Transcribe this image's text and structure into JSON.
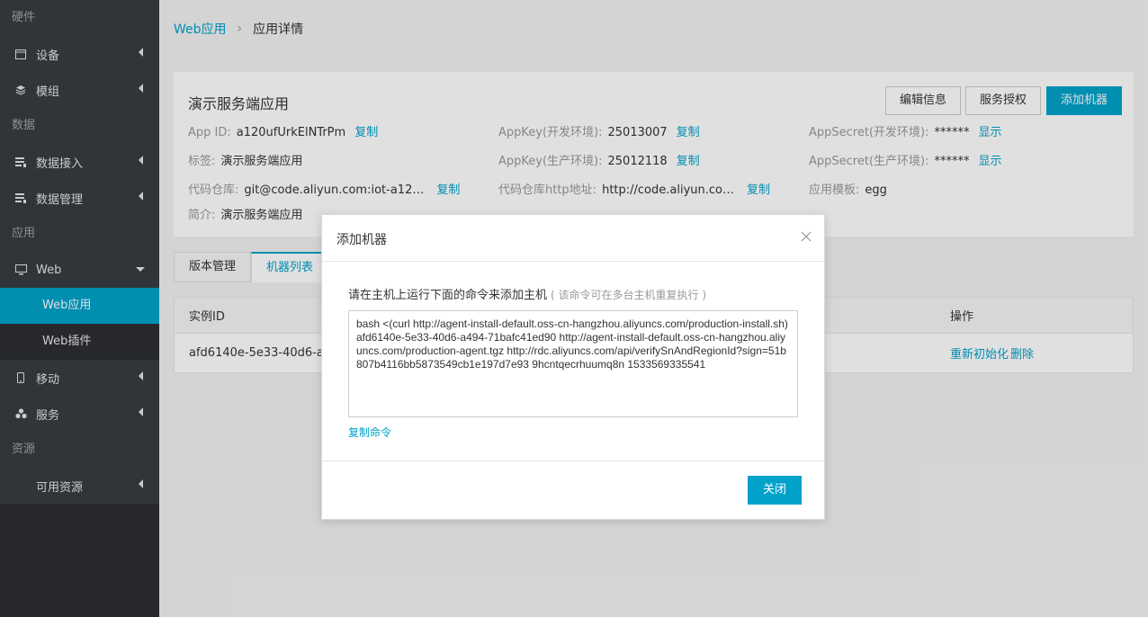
{
  "sidebar": {
    "sections": {
      "hardware": "硬件",
      "data": "数据",
      "app": "应用",
      "resource": "资源"
    },
    "items": {
      "device": "设备",
      "module": "模组",
      "data_access": "数据接入",
      "data_manage": "数据管理",
      "web": "Web",
      "web_app": "Web应用",
      "web_plugin": "Web插件",
      "mobile": "移动",
      "service": "服务",
      "available_resource": "可用资源"
    }
  },
  "breadcrumb": {
    "parent": "Web应用",
    "separator": "›",
    "current": "应用详情"
  },
  "info": {
    "title": "演示服务端应用",
    "buttons": {
      "edit": "编辑信息",
      "auth": "服务授权",
      "add_machine": "添加机器"
    },
    "app_id_label": "App ID:",
    "app_id_value": "a120ufUrkElNTrPm",
    "copy": "复制",
    "tag_label": "标签:",
    "tag_value": "演示服务端应用",
    "repo_label": "代码仓库:",
    "repo_value": "git@code.aliyun.com:iot-a12…",
    "desc_label": "简介:",
    "desc_value": "演示服务端应用",
    "appkey_dev_label": "AppKey(开发环境):",
    "appkey_dev_value": "25013007",
    "appkey_prod_label": "AppKey(生产环境):",
    "appkey_prod_value": "25012118",
    "repo_http_label": "代码仓库http地址:",
    "repo_http_value": "http://code.aliyun.co…",
    "secret_dev_label": "AppSecret(开发环境):",
    "secret_dev_value": "******",
    "secret_prod_label": "AppSecret(生产环境):",
    "secret_prod_value": "******",
    "show": "显示",
    "template_label": "应用模板:",
    "template_value": "egg"
  },
  "tabs": {
    "version": "版本管理",
    "machines": "机器列表"
  },
  "table": {
    "headers": {
      "instance_id": "实例ID",
      "actions": "操作"
    },
    "rows": [
      {
        "instance_id": "afd6140e-5e33-40d6-a494-",
        "reinit": "重新初始化",
        "delete": "删除"
      }
    ]
  },
  "dialog": {
    "title": "添加机器",
    "description": "请在主机上运行下面的命令来添加主机",
    "hint": "( 该命令可在多台主机重复执行 )",
    "command": "bash <(curl http://agent-install-default.oss-cn-hangzhou.aliyuncs.com/production-install.sh) afd6140e-5e33-40d6-a494-71bafc41ed90 http://agent-install-default.oss-cn-hangzhou.aliyuncs.com/production-agent.tgz http://rdc.aliyuncs.com/api/verifySnAndRegionId?sign=51b807b4116bb5873549cb1e197d7e93 9hcntqecrhuumq8n 1533569335541",
    "copy_command": "复制命令",
    "close_button": "关闭"
  },
  "colors": {
    "accent": "#00a2ca",
    "sidebar_bg": "#373d41",
    "sidebar_dark": "#2c2e33"
  }
}
